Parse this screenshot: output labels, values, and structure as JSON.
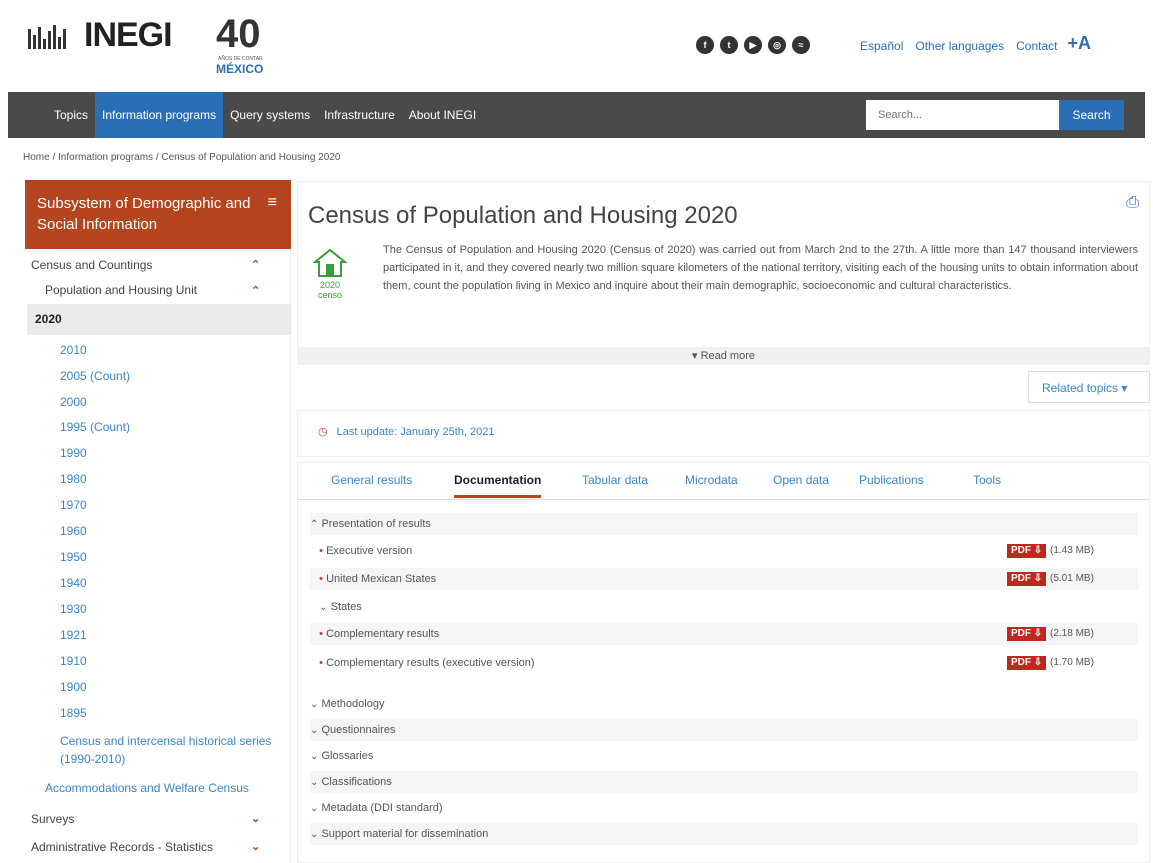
{
  "header": {
    "logo_text": "INEGI",
    "anniversary": "40",
    "anniversary_small": "AÑOS DE CONTAR",
    "mexico": "MÉXICO",
    "links": [
      "Español",
      "Other languages",
      "Contact"
    ],
    "font_size_label": "+A",
    "social_icons": [
      "facebook-icon",
      "twitter-icon",
      "youtube-icon",
      "instagram-icon",
      "rss-icon"
    ]
  },
  "nav": {
    "items": [
      "Topics",
      "Information programs",
      "Query systems",
      "Infrastructure",
      "About INEGI"
    ],
    "active": "Information programs",
    "search_placeholder": "Search...",
    "search_button": "Search"
  },
  "breadcrumb": "Home / Information programs / Census of Population and Housing 2020",
  "sidebar": {
    "title": "Subsystem of Demographic and Social Information",
    "items": [
      "Census and Countings",
      "Population and Housing Unit",
      "2020",
      "2010",
      "2005 (Count)",
      "2000",
      "1995 (Count)",
      "1990",
      "1980",
      "1970",
      "1960",
      "1950",
      "1940",
      "1930",
      "1921",
      "1910",
      "1900",
      "1895",
      "Census and intercensal historical series (1990-2010)",
      "Accommodations and Welfare Census",
      "Surveys",
      "Administrative Records - Statistics"
    ]
  },
  "main": {
    "title": "Census of Population and Housing 2020",
    "logo_text": "2020 censo",
    "description": "The Census of Population and Housing 2020 (Census of 2020) was carried out from March 2nd to the 27th. A little more than 147 thousand interviewers participated in it, and they covered nearly two million square kilometers of the national territory, visiting each of the housing units to obtain information about them, count the population living in Mexico and inquire about their main demographic, socioeconomic and cultural characteristics.",
    "read_more": "▾ Read more",
    "related_topics": "Related topics ▾",
    "last_update": "Last update: January 25th, 2021",
    "tabs": [
      "General results",
      "Documentation",
      "Tabular data",
      "Microdata",
      "Open data",
      "Publications",
      "Tools"
    ],
    "active_tab": "Documentation",
    "doc_section": "Presentation of results",
    "docs": [
      {
        "label": "Executive version",
        "badge": "PDF",
        "size": "(1.43 MB)"
      },
      {
        "label": "United Mexican States",
        "badge": "PDF",
        "size": "(5.01 MB)"
      },
      {
        "label": "States"
      },
      {
        "label": "Complementary results",
        "badge": "PDF",
        "size": "(2.18 MB)"
      },
      {
        "label": "Complementary results (executive version)",
        "badge": "PDF",
        "size": "(1.70 MB)"
      }
    ],
    "sections": [
      "Methodology",
      "Questionnaires",
      "Glossaries",
      "Classifications",
      "Metadata (DDI standard)",
      "Support material for dissemination"
    ]
  }
}
